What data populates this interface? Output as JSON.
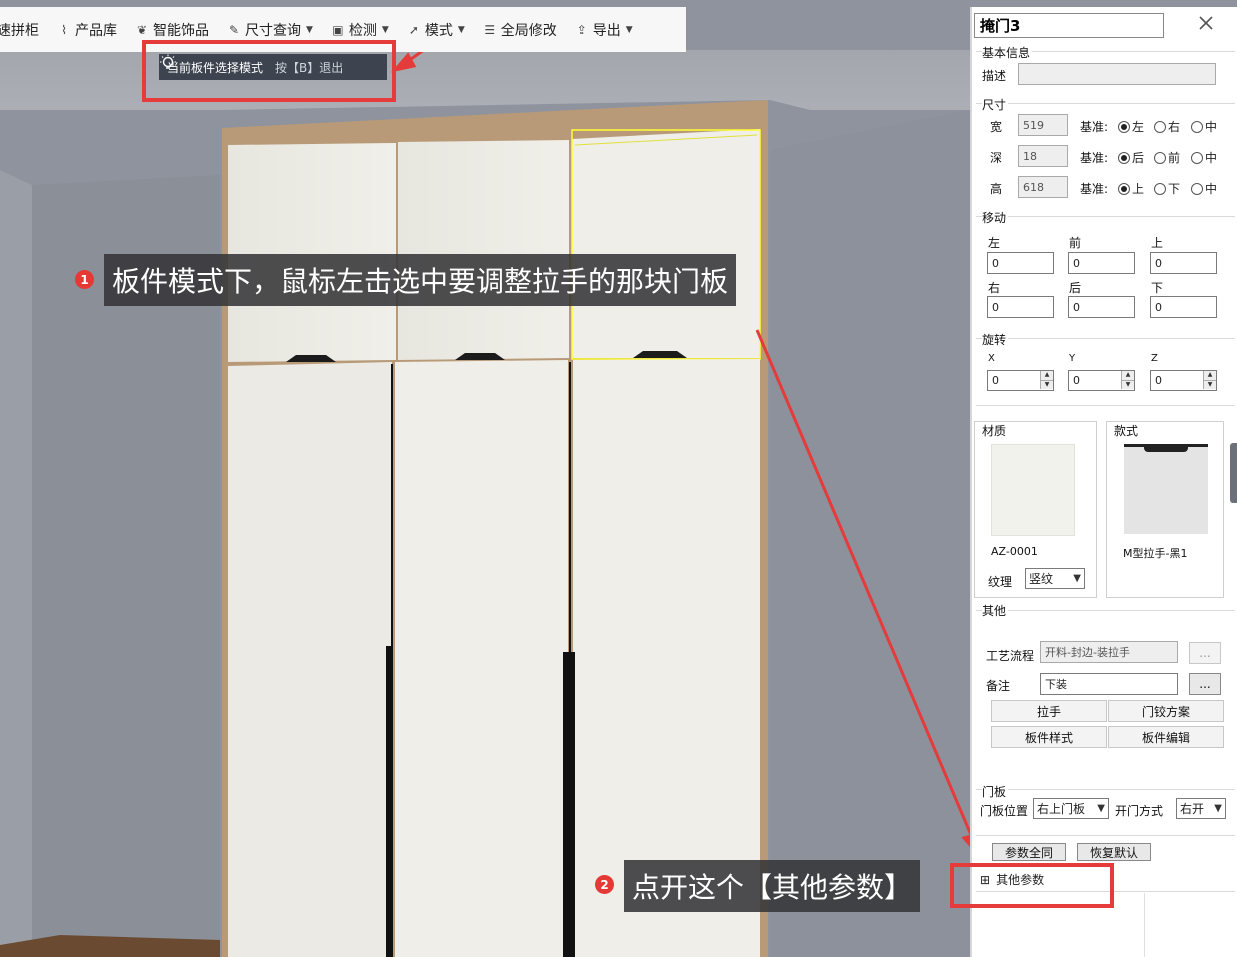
{
  "toolbar": {
    "items": [
      {
        "label": "速拼柜",
        "icon": "cabinet-icon"
      },
      {
        "label": "产品库",
        "icon": "hanger-icon"
      },
      {
        "label": "智能饰品",
        "icon": "decor-icon"
      },
      {
        "label": "尺寸查询",
        "icon": "ruler-icon",
        "dropdown": true
      },
      {
        "label": "检测",
        "icon": "inspect-icon",
        "dropdown": true
      },
      {
        "label": "模式",
        "icon": "cursor-icon",
        "dropdown": true
      },
      {
        "label": "全局修改",
        "icon": "sliders-icon"
      },
      {
        "label": "导出",
        "icon": "export-icon",
        "dropdown": true
      }
    ]
  },
  "mode_notice": {
    "text": "当前板件选择模式",
    "hint": "按【B】退出"
  },
  "annotations": {
    "step1_badge": "1",
    "step1_text": "板件模式下，鼠标左击选中要调整拉手的那块门板",
    "step2_badge": "2",
    "step2_text": "点开这个【其他参数】"
  },
  "panel": {
    "title": "掩门3",
    "basic": {
      "label": "基本信息",
      "desc_label": "描述",
      "desc_value": ""
    },
    "size": {
      "label": "尺寸",
      "width_label": "宽",
      "width_value": "519",
      "depth_label": "深",
      "depth_value": "18",
      "height_label": "高",
      "height_value": "618",
      "base_label": "基准:",
      "width_opts": [
        "左",
        "右",
        "中"
      ],
      "width_selected": "左",
      "depth_opts": [
        "后",
        "前",
        "中"
      ],
      "depth_selected": "后",
      "height_opts": [
        "上",
        "下",
        "中"
      ],
      "height_selected": "上"
    },
    "move": {
      "label": "移动",
      "left_label": "左",
      "left_value": "0",
      "front_label": "前",
      "front_value": "0",
      "up_label": "上",
      "up_value": "0",
      "right_label": "右",
      "right_value": "0",
      "back_label": "后",
      "back_value": "0",
      "down_label": "下",
      "down_value": "0"
    },
    "rotate": {
      "label": "旋转",
      "x_label": "X",
      "x_value": "0",
      "y_label": "Y",
      "y_value": "0",
      "z_label": "Z",
      "z_value": "0"
    },
    "material": {
      "label": "材质",
      "code": "AZ-0001",
      "texture_label": "纹理",
      "texture_value": "竖纹",
      "swatch_color": "#f2f2ec"
    },
    "style": {
      "label": "款式",
      "name": "M型拉手-黑1"
    },
    "other": {
      "label": "其他",
      "process_label": "工艺流程",
      "process_value": "开料-封边-装拉手",
      "note_label": "备注",
      "note_value": "下装",
      "more_label": "...",
      "buttons": [
        "拉手",
        "门铰方案",
        "板件样式",
        "板件编辑"
      ]
    },
    "door": {
      "label": "门板",
      "position_label": "门板位置",
      "position_value": "右上门板",
      "open_label": "开门方式",
      "open_value": "右开"
    },
    "actions": {
      "apply_all": "参数全同",
      "reset": "恢复默认"
    },
    "more_params": {
      "toggle": "⊞",
      "label": "其他参数"
    }
  },
  "colors": {
    "highlight_red": "#e53b3b",
    "wall": "#8e939e",
    "door": "#ecebe5",
    "frame_wood": "#b89a78",
    "selection_yellow": "#ffff33"
  }
}
